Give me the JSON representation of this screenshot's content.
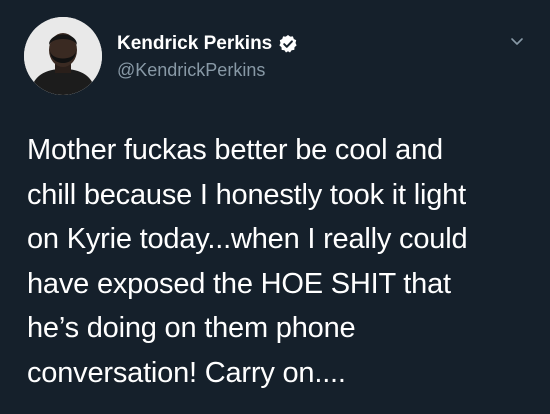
{
  "author": {
    "display_name": "Kendrick Perkins",
    "handle": "@KendrickPerkins",
    "verified": true
  },
  "tweet": {
    "lines": [
      "Mother fuckas better be cool and",
      "chill because I honestly took it light",
      "on Kyrie today...when I really could",
      "have exposed the HOE SHIT that",
      "he’s doing on them phone",
      "conversation! Carry on...."
    ]
  },
  "icons": {
    "verified": "verified-badge-icon",
    "menu": "chevron-down-icon"
  },
  "colors": {
    "background": "#15202b",
    "text_primary": "#ffffff",
    "text_secondary": "#8899a6",
    "verified_badge": "#ffffff"
  }
}
